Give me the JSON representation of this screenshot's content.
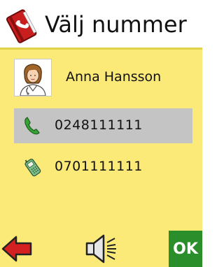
{
  "header": {
    "title": "Välj nummer",
    "icon": "phonebook-icon"
  },
  "contact": {
    "name": "Anna Hansson",
    "avatar": "doctor-avatar-icon"
  },
  "numbers": [
    {
      "number": "0248111111",
      "icon": "landline-phone-icon",
      "selected": true
    },
    {
      "number": "0701111111",
      "icon": "mobile-phone-icon",
      "selected": false
    }
  ],
  "toolbar": {
    "back": "back-arrow-icon",
    "speaker": "speaker-icon",
    "ok_label": "OK"
  },
  "colors": {
    "background": "#fbea78",
    "selected_row": "#c4c4c4",
    "ok_button": "#2a8f2a",
    "back_arrow": "#d42020"
  }
}
